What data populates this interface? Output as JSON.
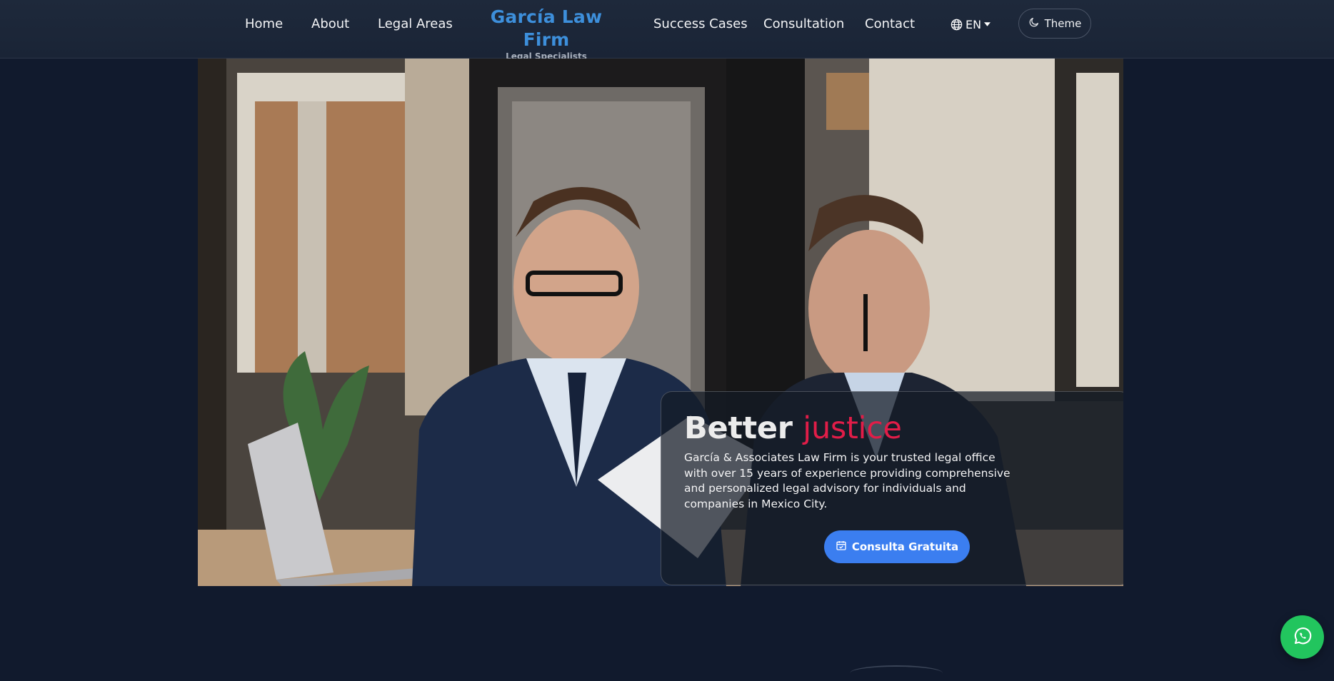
{
  "nav": {
    "links": [
      "Home",
      "About",
      "Legal Areas",
      "Success Cases",
      "Consultation",
      "Contact"
    ],
    "brand": {
      "title": "García Law Firm",
      "subtitle": "Legal Specialists"
    },
    "language": {
      "label": "EN",
      "icon": "globe-icon"
    },
    "theme": {
      "label": "Theme",
      "icon": "moon-icon"
    }
  },
  "hero": {
    "title_part1": "Better",
    "title_part2": "justice",
    "description": "García & Associates Law Firm is your trusted legal office with over 15 years of experience providing comprehensive and personalized legal advisory for individuals and companies in Mexico City.",
    "cta_label": "Consulta Gratuita",
    "cta_icon": "calendar-check-icon"
  },
  "floating": {
    "whatsapp_icon": "whatsapp-icon"
  },
  "colors": {
    "background": "#111a2d",
    "navbar": "#1e293b",
    "brand": "#3d8fdb",
    "accent_red": "#e11d48",
    "cta_blue": "#3b7ef0",
    "whatsapp_green": "#22c55e"
  }
}
